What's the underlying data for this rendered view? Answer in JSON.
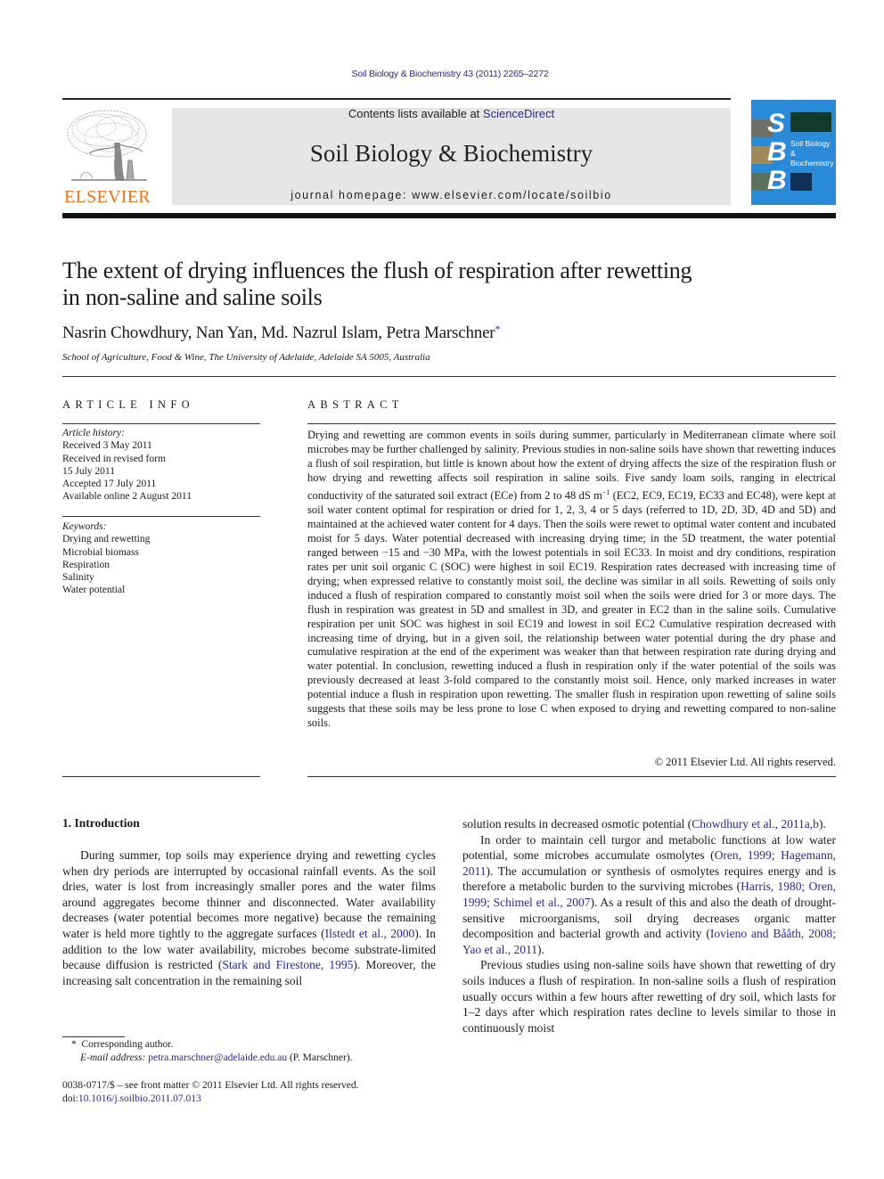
{
  "header": {
    "citation": "Soil Biology & Biochemistry 43 (2011) 2265–2272",
    "contents_prefix": "Contents lists available at ",
    "contents_link": "ScienceDirect",
    "journal_name": "Soil Biology & Biochemistry",
    "homepage_label": "journal homepage: www.elsevier.com/locate/soilbio",
    "publisher_logo_text": "ELSEVIER",
    "cover": {
      "letters": [
        "S",
        "B",
        "B"
      ],
      "title_line1": "Soil Biology &",
      "title_line2": "Biochemistry",
      "color": "#2a8ad8"
    }
  },
  "article": {
    "title_line1": "The extent of drying influences the flush of respiration after rewetting",
    "title_line2": "in non-saline and saline soils",
    "authors": "Nasrin Chowdhury, Nan Yan, Md. Nazrul Islam, Petra Marschner",
    "corresponding_mark": "*",
    "affiliation": "School of Agriculture, Food & Wine, The University of Adelaide, Adelaide SA 5005, Australia"
  },
  "article_info": {
    "heading": "ARTICLE INFO",
    "history_label": "Article history:",
    "history": [
      "Received 3 May 2011",
      "Received in revised form",
      "15 July 2011",
      "Accepted 17 July 2011",
      "Available online 2 August 2011"
    ],
    "keywords_label": "Keywords:",
    "keywords": [
      "Drying and rewetting",
      "Microbial biomass",
      "Respiration",
      "Salinity",
      "Water potential"
    ]
  },
  "abstract": {
    "heading": "ABSTRACT",
    "text_part1": "Drying and rewetting are common events in soils during summer, particularly in Mediterranean climate where soil microbes may be further challenged by salinity. Previous studies in non-saline soils have shown that rewetting induces a flush of soil respiration, but little is known about how the extent of drying affects the size of the respiration flush or how drying and rewetting affects soil respiration in saline soils. Five sandy loam soils, ranging in electrical conductivity of the saturated soil extract (ECe) from 2 to 48 dS m",
    "superscript": "−1",
    "text_part2": " (EC2, EC9, EC19, EC33 and EC48), were kept at soil water content optimal for respiration or dried for 1, 2, 3, 4 or 5 days (referred to 1D, 2D, 3D, 4D and 5D) and maintained at the achieved water content for 4 days. Then the soils were rewet to optimal water content and incubated moist for 5 days. Water potential decreased with increasing drying time; in the 5D treatment, the water potential ranged between −15 and −30 MPa, with the lowest potentials in soil EC33. In moist and dry conditions, respiration rates per unit soil organic C (SOC) were highest in soil EC19. Respiration rates decreased with increasing time of drying; when expressed relative to constantly moist soil, the decline was similar in all soils. Rewetting of soils only induced a flush of respiration compared to constantly moist soil when the soils were dried for 3 or more days. The flush in respiration was greatest in 5D and smallest in 3D, and greater in EC2 than in the saline soils. Cumulative respiration per unit SOC was highest in soil EC19 and lowest in soil EC2 Cumulative respiration decreased with increasing time of drying, but in a given soil, the relationship between water potential during the dry phase and cumulative respiration at the end of the experiment was weaker than that between respiration rate during drying and water potential. In conclusion, rewetting induced a flush in respiration only if the water potential of the soils was previously decreased at least 3-fold compared to the constantly moist soil. Hence, only marked increases in water potential induce a flush in respiration upon rewetting. The smaller flush in respiration upon rewetting of saline soils suggests that these soils may be less prone to lose C when exposed to drying and rewetting compared to non-saline soils.",
    "copyright": "© 2011 Elsevier Ltd. All rights reserved."
  },
  "introduction": {
    "heading": "1.  Introduction",
    "left_p1_a": "During summer, top soils may experience drying and rewetting cycles when dry periods are interrupted by occasional rainfall events. As the soil dries, water is lost from increasingly smaller pores and the water films around aggregates become thinner and disconnected. Water availability decreases (water potential becomes more negative) because the remaining water is held more tightly to the aggregate surfaces (",
    "ref_ilstedt": "Ilstedt et al., 2000",
    "left_p1_b": "). In addition to the low water availability, microbes become substrate-limited because diffusion is restricted (",
    "ref_stark": "Stark and Firestone, 1995",
    "left_p1_c": "). Moreover, the increasing salt concentration in the remaining soil",
    "right_p1_a": "solution results in decreased osmotic potential (",
    "ref_chowdhury": "Chowdhury et al., 2011a,b",
    "right_p1_b": ").",
    "right_p2_a": "In order to maintain cell turgor and metabolic functions at low water potential, some microbes accumulate osmolytes (",
    "ref_oren_hagemann": "Oren, 1999; Hagemann, 2011",
    "right_p2_b": "). The accumulation or synthesis of osmolytes requires energy and is therefore a metabolic burden to the surviving microbes (",
    "ref_harris": "Harris, 1980; Oren, 1999; Schimel et al., 2007",
    "right_p2_c": "). As a result of this and also the death of drought-sensitive microorganisms, soil drying decreases organic matter decomposition and bacterial growth and activity (",
    "ref_iovieno": "Iovieno and Bååth, 2008; Yao et al., 2011",
    "right_p2_d": ").",
    "right_p3": "Previous studies using non-saline soils have shown that rewetting of dry soils induces a flush of respiration. In non-saline soils a flush of respiration usually occurs within a few hours after rewetting of dry soil, which lasts for 1–2 days after which respiration rates decline to levels similar to those in continuously moist"
  },
  "footnote": {
    "mark": "*",
    "corresponding": "Corresponding author.",
    "email_label": "E-mail address: ",
    "email": "petra.marschner@adelaide.edu.au",
    "email_suffix": " (P. Marschner)."
  },
  "front_matter": {
    "issn_line": "0038-0717/$ – see front matter © 2011 Elsevier Ltd. All rights reserved.",
    "doi_label": "doi:",
    "doi": "10.1016/j.soilbio.2011.07.013"
  },
  "colors": {
    "link": "#2a2a8c",
    "elsevier_orange": "#e8731b",
    "masthead_bg": "#e6e6e6"
  }
}
